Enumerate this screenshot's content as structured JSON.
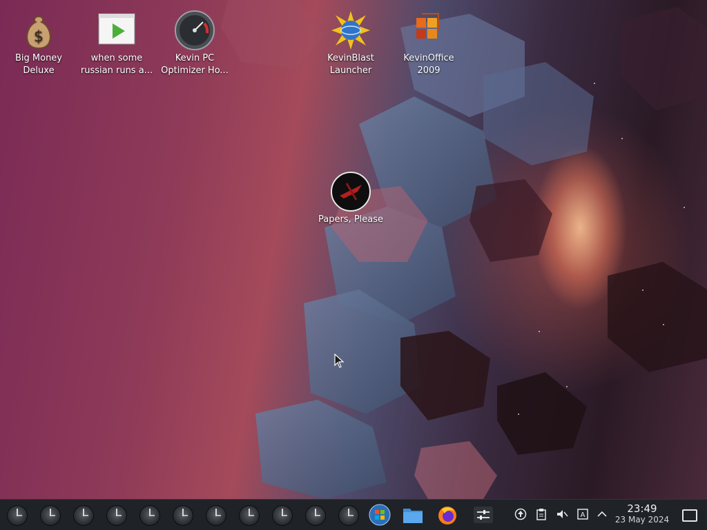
{
  "desktop": {
    "icons": [
      {
        "label": "Big Money Deluxe",
        "icon": "money-bag-icon"
      },
      {
        "label": "when some russian runs a...",
        "icon": "video-player-icon"
      },
      {
        "label": "Kevin PC Optimizer Ho...",
        "icon": "speedometer-icon"
      },
      {
        "label": "KevinBlast Launcher",
        "icon": "globe-burst-icon"
      },
      {
        "label": "KevinOffice 2009",
        "icon": "office-icon"
      },
      {
        "label": "Papers, Please",
        "icon": "papers-please-icon"
      }
    ]
  },
  "taskbar": {
    "pinned_clock_items_count": 11,
    "apps": [
      {
        "name": "windows-orb",
        "icon": "windows-start-icon"
      },
      {
        "name": "file-manager",
        "icon": "folder-icon"
      },
      {
        "name": "firefox",
        "icon": "firefox-icon"
      },
      {
        "name": "settings-sliders",
        "icon": "sliders-icon"
      }
    ],
    "tray": [
      {
        "name": "update",
        "icon": "upload-arrow-icon"
      },
      {
        "name": "clipboard",
        "icon": "clipboard-icon"
      },
      {
        "name": "volume",
        "icon": "volume-muted-icon"
      },
      {
        "name": "input-method",
        "icon": "keyboard-layout-icon"
      },
      {
        "name": "expand",
        "icon": "chevron-up-icon"
      }
    ],
    "clock": {
      "time": "23:49",
      "date": "23 May 2024"
    }
  },
  "colors": {
    "taskbar": "#1f2327",
    "text": "#ffffff"
  }
}
